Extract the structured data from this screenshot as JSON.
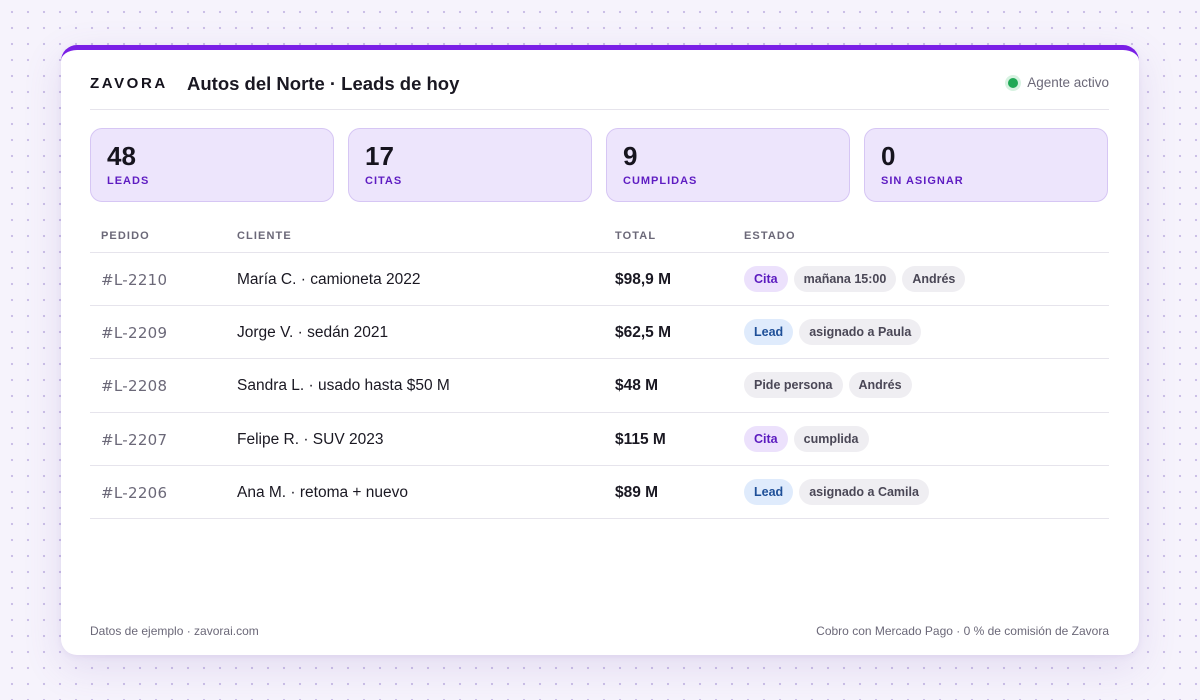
{
  "header": {
    "logo": "ZAVORA",
    "title": "Autos del Norte · Leads de hoy",
    "agent_status": "Agente activo"
  },
  "stats": [
    {
      "value": "48",
      "label": "LEADS"
    },
    {
      "value": "17",
      "label": "CITAS"
    },
    {
      "value": "9",
      "label": "CUMPLIDAS"
    },
    {
      "value": "0",
      "label": "SIN ASIGNAR"
    }
  ],
  "table": {
    "columns": [
      "PEDIDO",
      "CLIENTE",
      "TOTAL",
      "ESTADO"
    ],
    "rows": [
      {
        "pedido": "#L-2210",
        "cliente": "María C. · camioneta 2022",
        "total": "$98,9 M",
        "tags": [
          {
            "text": "Cita",
            "kind": "cita"
          },
          {
            "text": "mañana 15:00",
            "kind": "neutral"
          },
          {
            "text": "Andrés",
            "kind": "neutral"
          }
        ]
      },
      {
        "pedido": "#L-2209",
        "cliente": "Jorge V. · sedán 2021",
        "total": "$62,5 M",
        "tags": [
          {
            "text": "Lead",
            "kind": "lead"
          },
          {
            "text": "asignado a Paula",
            "kind": "neutral"
          }
        ]
      },
      {
        "pedido": "#L-2208",
        "cliente": "Sandra L. · usado hasta $50 M",
        "total": "$48 M",
        "tags": [
          {
            "text": "Pide persona",
            "kind": "neutral"
          },
          {
            "text": "Andrés",
            "kind": "neutral"
          }
        ]
      },
      {
        "pedido": "#L-2207",
        "cliente": "Felipe R. · SUV 2023",
        "total": "$115 M",
        "tags": [
          {
            "text": "Cita",
            "kind": "cita"
          },
          {
            "text": "cumplida",
            "kind": "neutral"
          }
        ]
      },
      {
        "pedido": "#L-2206",
        "cliente": "Ana M. · retoma + nuevo",
        "total": "$89 M",
        "tags": [
          {
            "text": "Lead",
            "kind": "lead"
          },
          {
            "text": "asignado a Camila",
            "kind": "neutral"
          }
        ]
      }
    ]
  },
  "footer": {
    "left": "Datos de ejemplo · zavorai.com",
    "right": "Cobro con Mercado Pago · 0 % de comisión de Zavora"
  },
  "colors": {
    "accent": "#7a1fe6",
    "status_active": "#1fa855",
    "stat_background": "#ede5fc"
  }
}
